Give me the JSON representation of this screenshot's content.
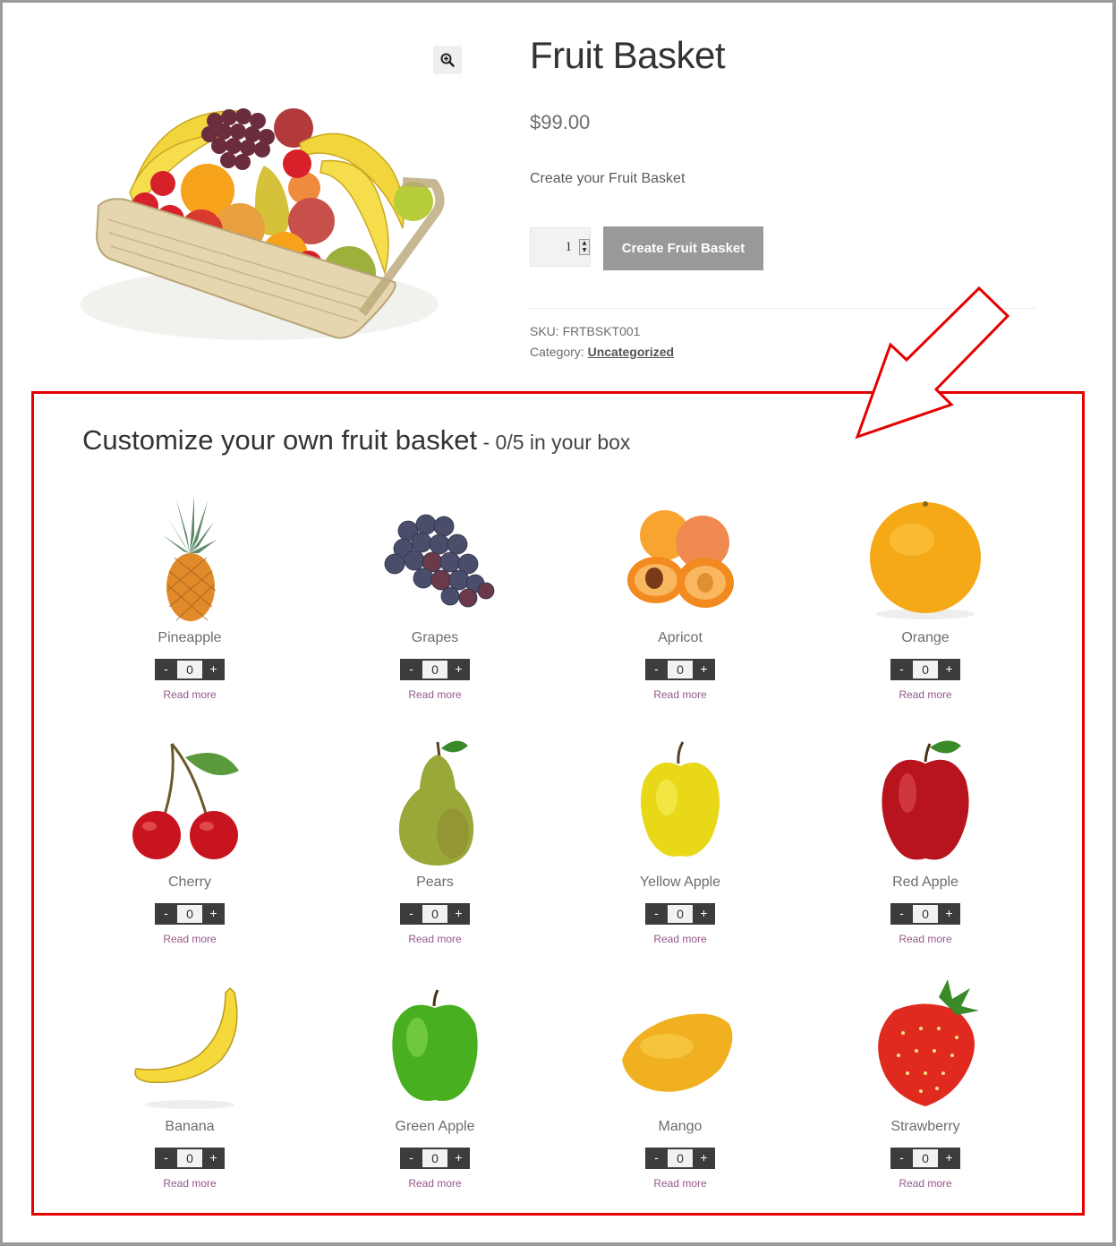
{
  "product": {
    "title": "Fruit Basket",
    "price": "$99.00",
    "description": "Create your Fruit Basket",
    "quantity": "1",
    "add_button_label": "Create Fruit Basket",
    "sku_label": "SKU:",
    "sku_value": "FRTBSKT001",
    "category_label": "Category:",
    "category_value": "Uncategorized",
    "zoom_icon": "magnifier-plus-icon"
  },
  "annotation": {
    "color": "#e60000"
  },
  "customizer": {
    "title": "Customize your own fruit basket",
    "separator": " - ",
    "count_text": "0/5 in your box",
    "read_more_label": "Read more",
    "minus_label": "-",
    "plus_label": "+",
    "items": [
      {
        "name": "Pineapple",
        "qty": "0",
        "icon": "pineapple"
      },
      {
        "name": "Grapes",
        "qty": "0",
        "icon": "grapes"
      },
      {
        "name": "Apricot",
        "qty": "0",
        "icon": "apricot"
      },
      {
        "name": "Orange",
        "qty": "0",
        "icon": "orange"
      },
      {
        "name": "Cherry",
        "qty": "0",
        "icon": "cherry"
      },
      {
        "name": "Pears",
        "qty": "0",
        "icon": "pear"
      },
      {
        "name": "Yellow Apple",
        "qty": "0",
        "icon": "yellow-apple"
      },
      {
        "name": "Red Apple",
        "qty": "0",
        "icon": "red-apple"
      },
      {
        "name": "Banana",
        "qty": "0",
        "icon": "banana"
      },
      {
        "name": "Green Apple",
        "qty": "0",
        "icon": "green-apple"
      },
      {
        "name": "Mango",
        "qty": "0",
        "icon": "mango"
      },
      {
        "name": "Strawberry",
        "qty": "0",
        "icon": "strawberry"
      }
    ]
  }
}
